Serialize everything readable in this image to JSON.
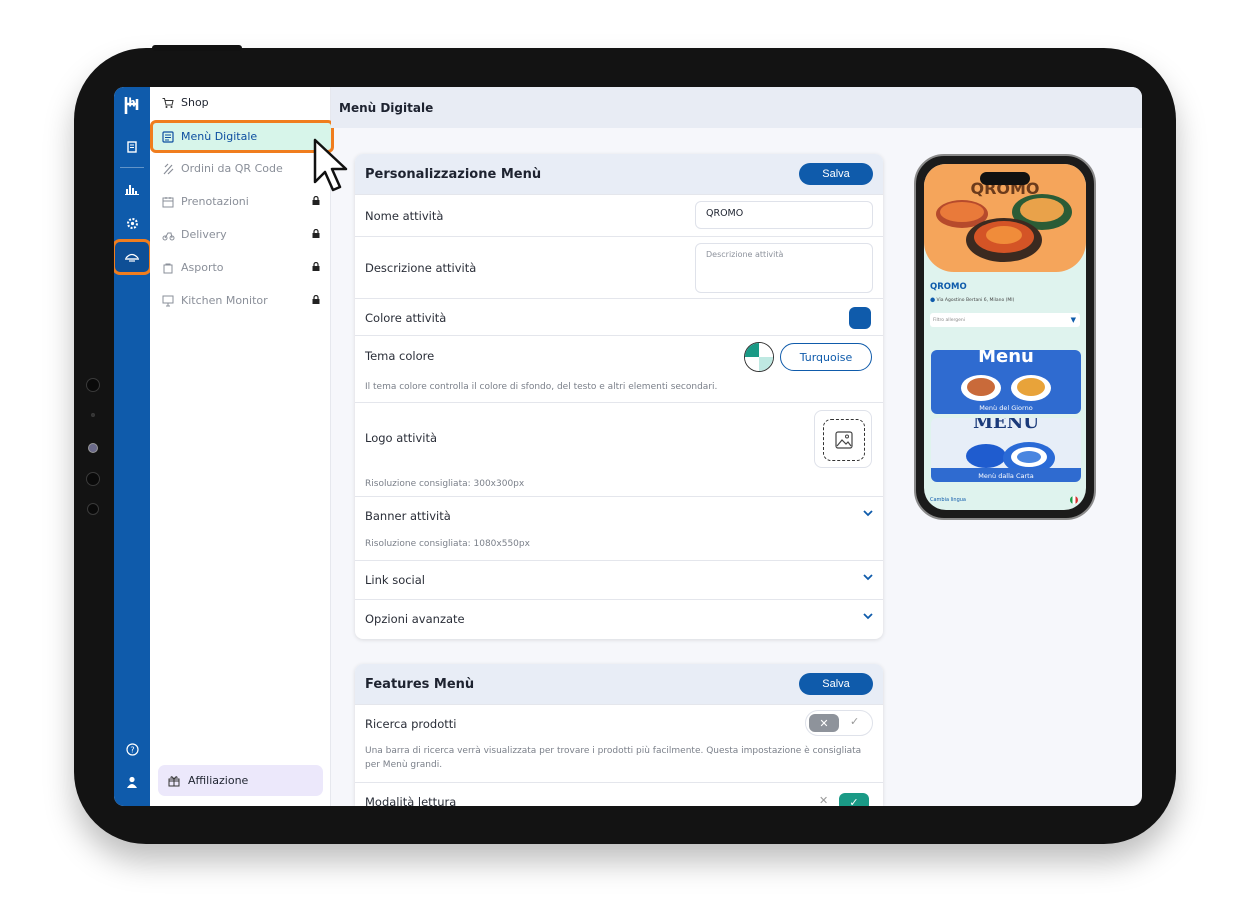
{
  "topbar": {
    "title": "Menù Digitale"
  },
  "rail": {
    "items": [
      {
        "icon": "logo-icon"
      },
      {
        "icon": "receipt-icon"
      },
      {
        "icon": "bar-chart-icon"
      },
      {
        "icon": "gear-icon"
      },
      {
        "icon": "menu-digital-icon",
        "active": true
      },
      {
        "icon": "help-icon"
      },
      {
        "icon": "user-icon"
      }
    ]
  },
  "subnav": {
    "items": [
      {
        "label": "Shop",
        "icon": "cart-icon",
        "locked": false
      },
      {
        "label": "Menù Digitale",
        "icon": "menu-icon",
        "active": true
      },
      {
        "label": "Ordini da QR Code",
        "icon": "qr-icon",
        "locked": true
      },
      {
        "label": "Prenotazioni",
        "icon": "calendar-icon",
        "locked": true
      },
      {
        "label": "Delivery",
        "icon": "delivery-icon",
        "locked": true
      },
      {
        "label": "Asporto",
        "icon": "bag-icon",
        "locked": true
      },
      {
        "label": "Kitchen Monitor",
        "icon": "monitor-icon",
        "locked": true
      }
    ],
    "affiliazione": "Affiliazione"
  },
  "personalizzazione": {
    "title": "Personalizzazione Menù",
    "save": "Salva",
    "nome_label": "Nome attività",
    "nome_value": "QROMO",
    "descrizione_label": "Descrizione attività",
    "descrizione_placeholder": "Descrizione attività",
    "colore_label": "Colore attività",
    "colore_value": "#0f5bab",
    "tema_label": "Tema colore",
    "tema_value": "Turquoise",
    "tema_hint": "Il tema colore controlla il colore di sfondo, del testo e altri elementi secondari.",
    "logo_label": "Logo attività",
    "logo_hint": "Risoluzione consigliata: 300x300px",
    "banner_label": "Banner attività",
    "banner_hint": "Risoluzione consigliata: 1080x550px",
    "social_label": "Link social",
    "opzioni_label": "Opzioni avanzate"
  },
  "features": {
    "title": "Features Menù",
    "save": "Salva",
    "ricerca_label": "Ricerca prodotti",
    "ricerca_enabled": false,
    "ricerca_hint": "Una barra di ricerca verrà visualizzata per trovare i prodotti più facilmente. Questa impostazione è consigliata per Menù grandi.",
    "lettura_label": "Modalità lettura",
    "lettura_enabled": true
  },
  "phone": {
    "hero_title": "QROMO",
    "name": "QROMO",
    "address": "Via Agostino Bertani 6, Milano (MI)",
    "filter": "Filtro allergeni",
    "card1_title": "Menu",
    "card1_label": "Menù del Giorno",
    "card2_title": "MENU",
    "card2_label": "Menù dalla Carta",
    "language": "Cambia lingua"
  },
  "colors": {
    "primary": "#0f5bab",
    "highlight": "#f07d1e",
    "active_bg": "#d7f5ea"
  }
}
